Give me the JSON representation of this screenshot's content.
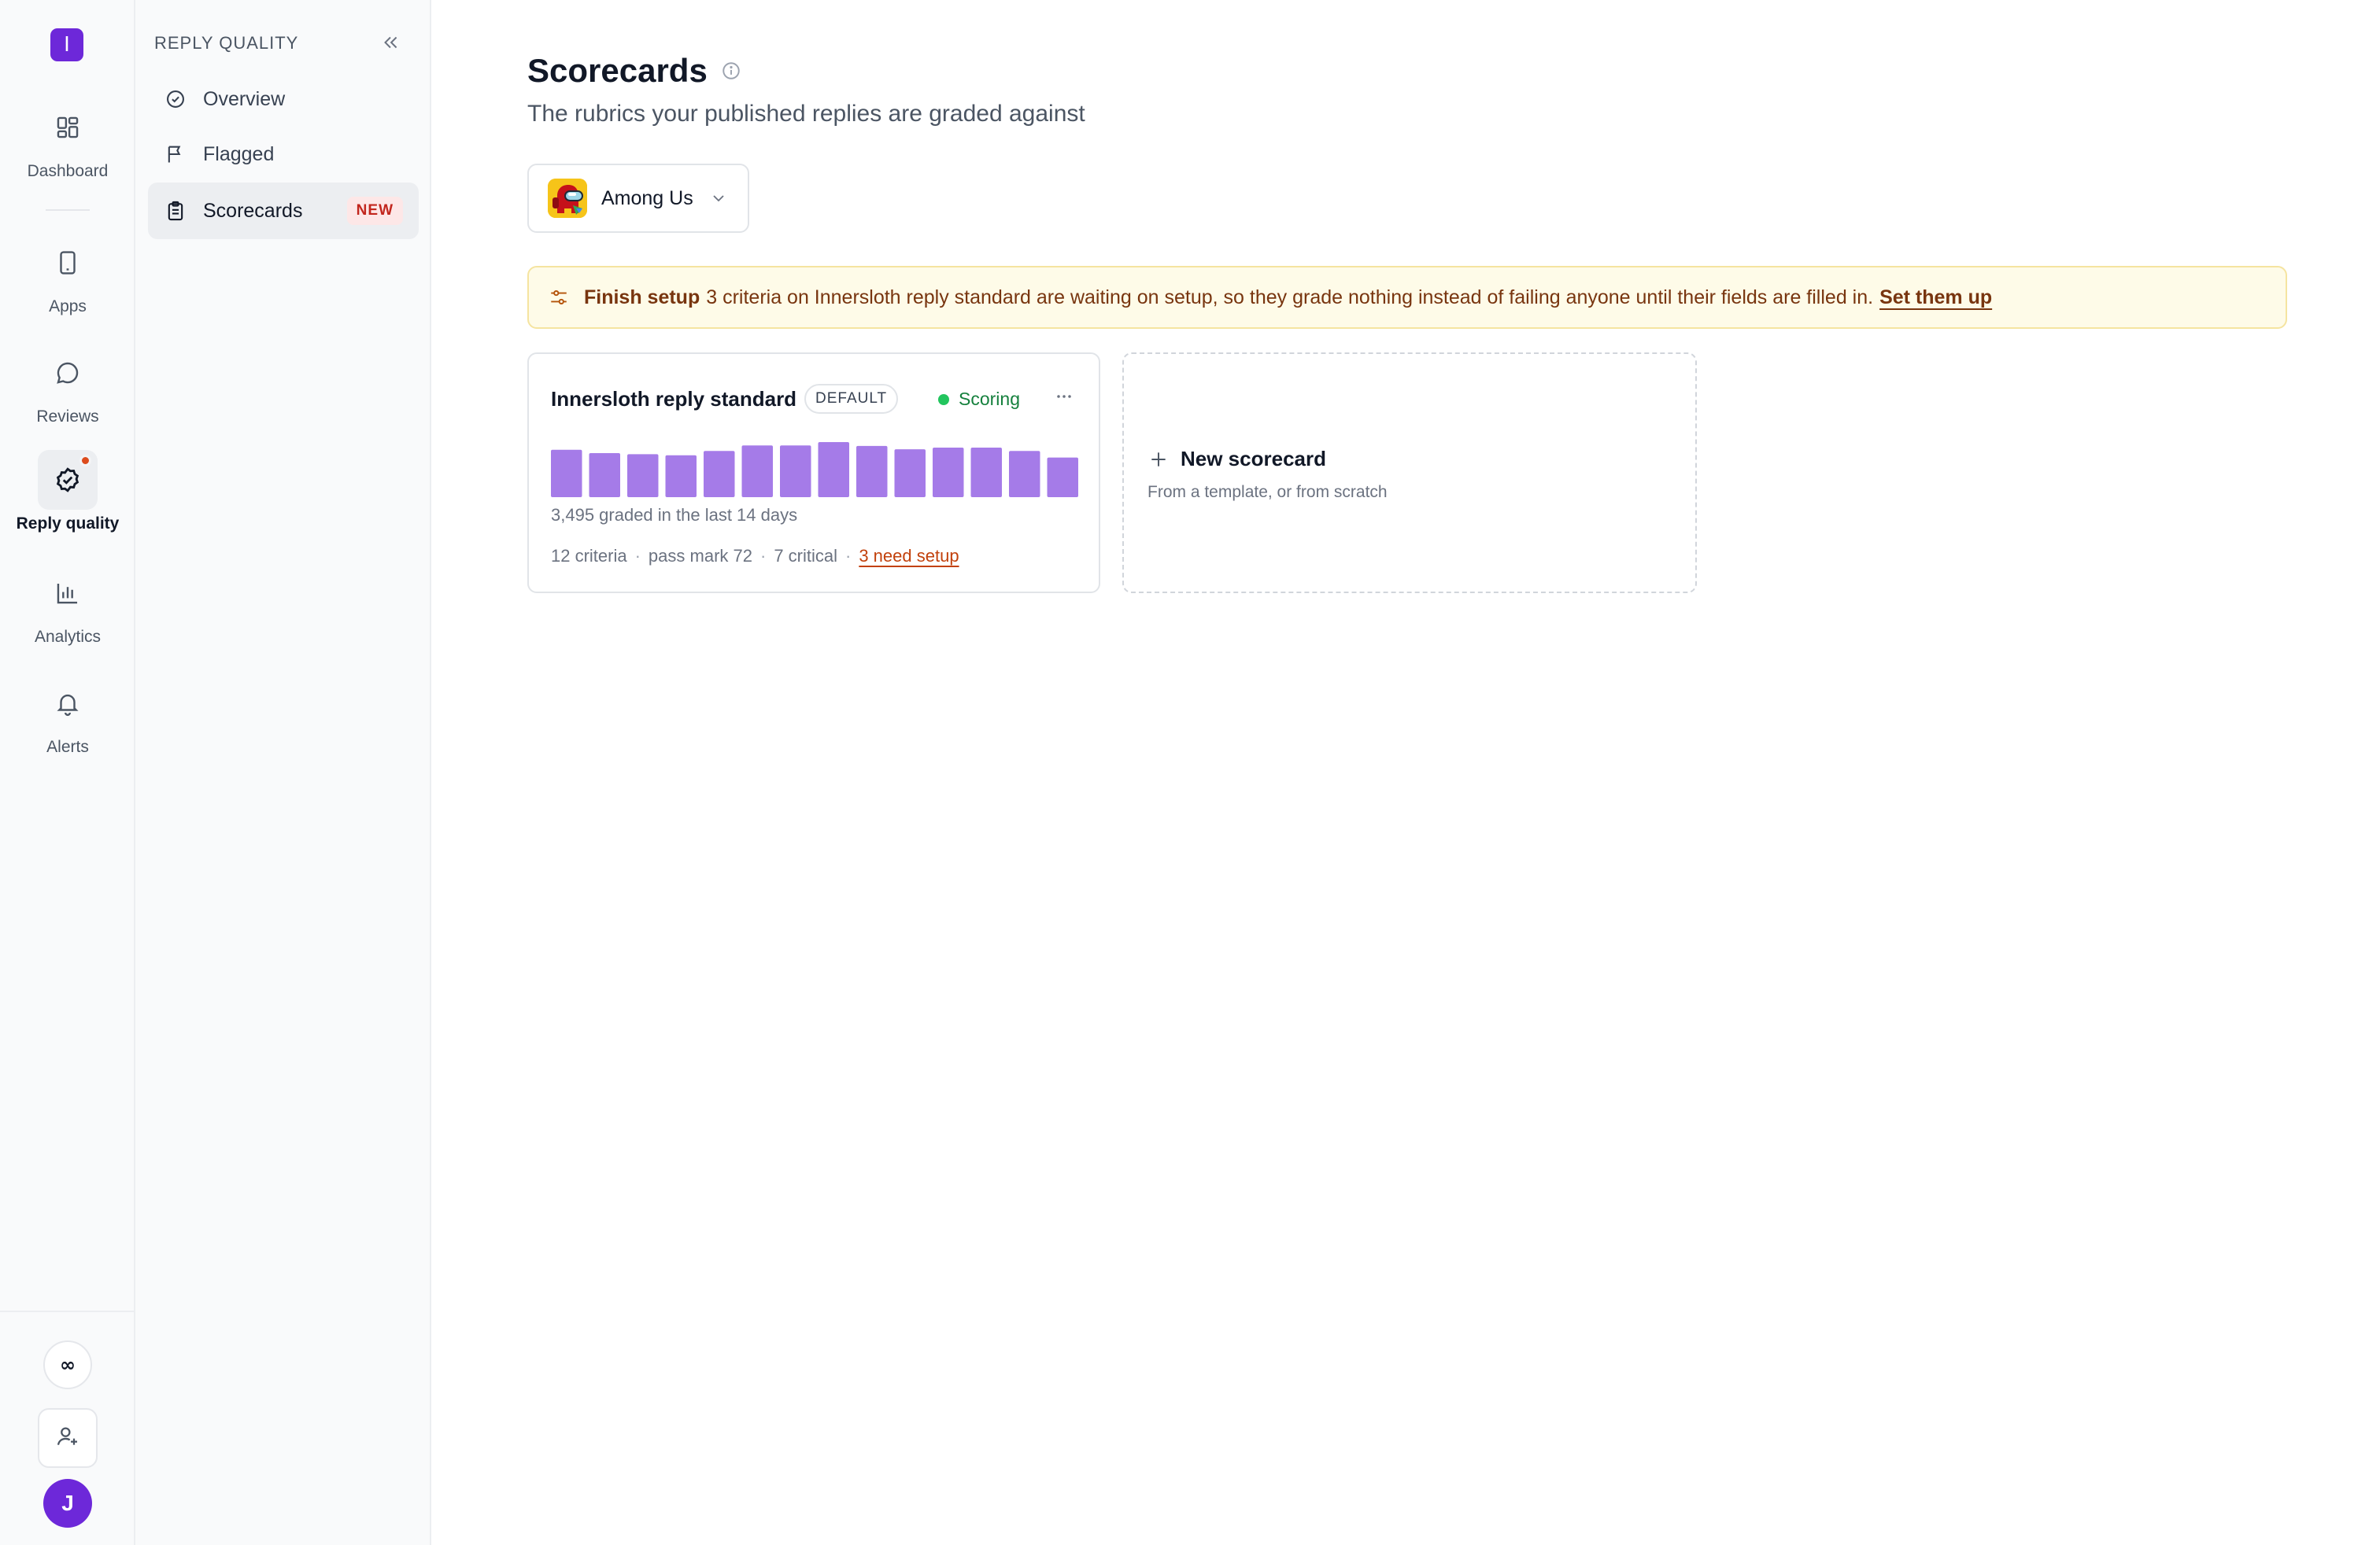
{
  "rail": {
    "logo_letter": "I",
    "items": [
      {
        "label": "Dashboard",
        "icon": "dashboard-icon"
      },
      {
        "label": "Apps",
        "icon": "phone-icon"
      },
      {
        "label": "Reviews",
        "icon": "chat-bubble-icon"
      },
      {
        "label": "Reply quality",
        "icon": "badge-check-icon",
        "active": true,
        "has_dot": true
      },
      {
        "label": "Analytics",
        "icon": "bar-chart-icon"
      },
      {
        "label": "Alerts",
        "icon": "bell-icon"
      }
    ],
    "bottom": {
      "infinity_label": "∞",
      "invite_icon": "user-plus-icon",
      "avatar_letter": "J"
    }
  },
  "sidebar": {
    "title": "REPLY QUALITY",
    "collapse_icon": "chevrons-left-icon",
    "items": [
      {
        "label": "Overview",
        "icon": "check-circle-icon"
      },
      {
        "label": "Flagged",
        "icon": "flag-icon"
      },
      {
        "label": "Scorecards",
        "icon": "clipboard-icon",
        "active": true,
        "badge": "NEW"
      }
    ]
  },
  "main": {
    "title": "Scorecards",
    "subtitle": "The rubrics your published replies are graded against",
    "app_select": {
      "label": "Among Us",
      "icon": "among-us-app-icon"
    },
    "banner": {
      "strong": "Finish setup",
      "text": "3 criteria on Innersloth reply standard are waiting on setup, so they grade nothing instead of failing anyone until their fields are filled in.",
      "link": "Set them up"
    },
    "scorecard": {
      "name": "Innersloth reply standard",
      "badge": "DEFAULT",
      "status": "Scoring",
      "graded_text": "3,495 graded in the last 14 days",
      "criteria": "12 criteria",
      "pass_mark": "pass mark 72",
      "critical": "7 critical",
      "need_setup": "3 need setup",
      "daily_graded_relative": [
        0.86,
        0.8,
        0.78,
        0.76,
        0.84,
        0.94,
        0.94,
        1.0,
        0.93,
        0.87,
        0.9,
        0.9,
        0.84,
        0.72
      ]
    },
    "new_card": {
      "title": "New scorecard",
      "subtitle": "From a template, or from scratch"
    }
  },
  "colors": {
    "accent": "#6d28d9",
    "bar": "#a57be8",
    "status_green": "#22c55e",
    "warning_bg": "#fefbe8",
    "warning_text": "#78350f",
    "link_orange": "#c2410c"
  }
}
